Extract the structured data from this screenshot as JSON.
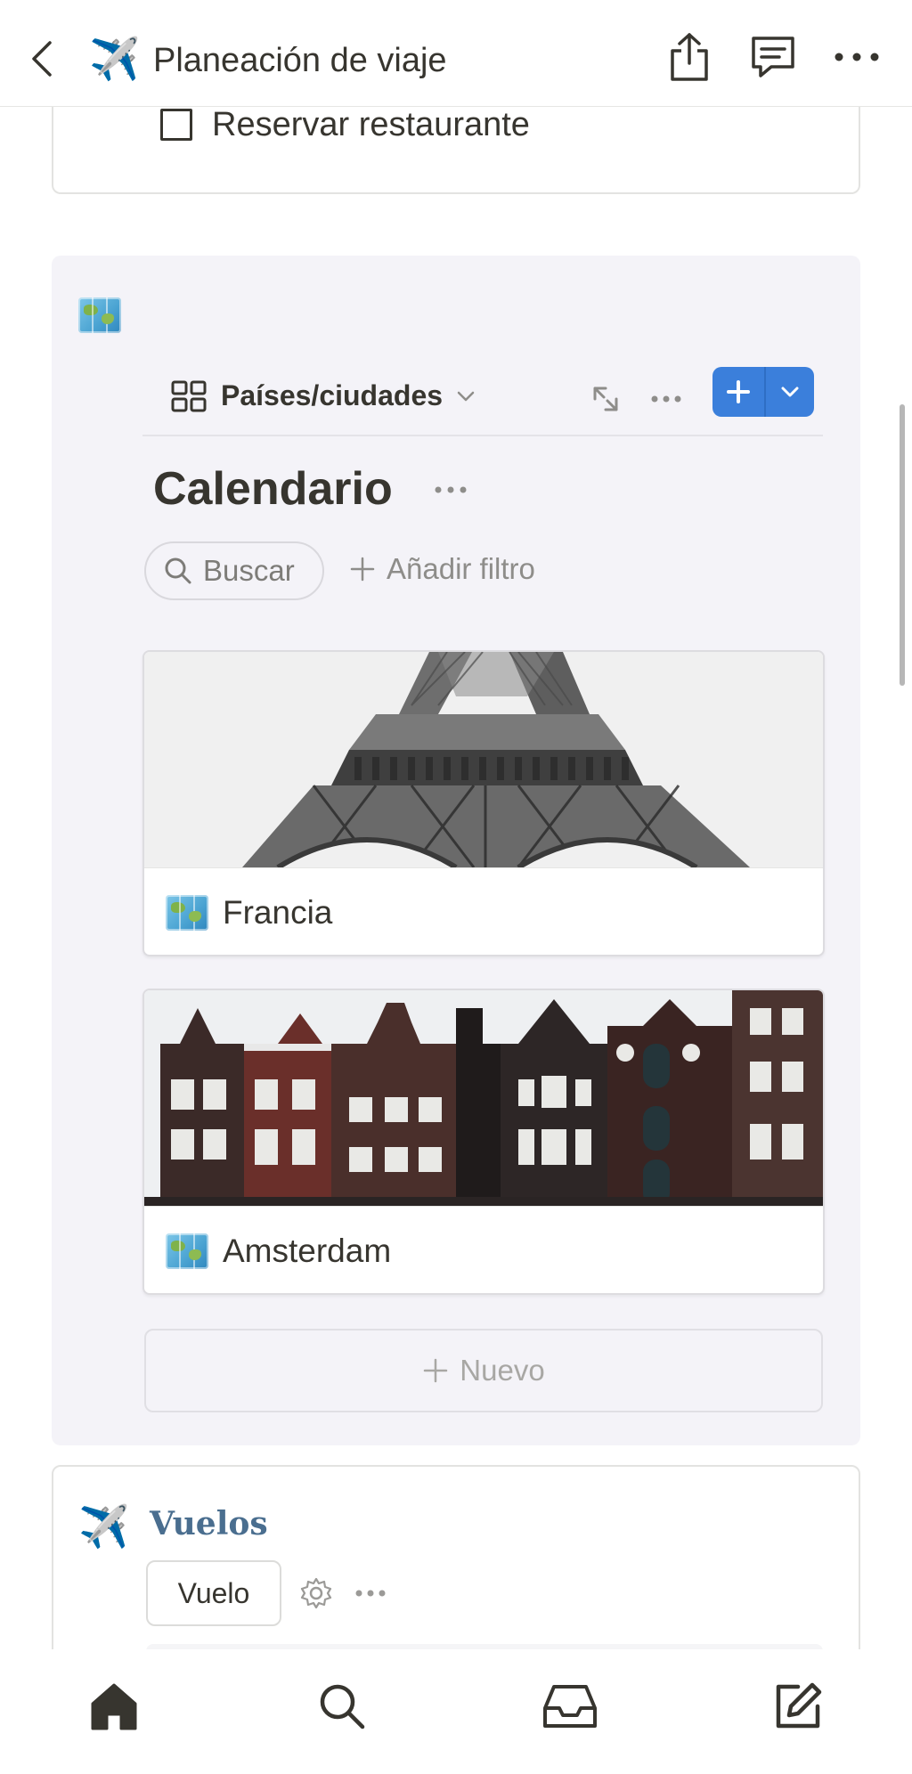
{
  "header": {
    "title": "Planeación de viaje",
    "page_icon": "✈️",
    "back_icon": "chevron-left-icon",
    "share_icon": "share-icon",
    "comment_icon": "comment-icon",
    "more_icon": "more-icon"
  },
  "checklist": {
    "item_label": "Reservar restaurante",
    "checked": false
  },
  "database": {
    "icon": "map-icon",
    "view_name": "Países/ciudades",
    "title": "Calendario",
    "search_label": "Buscar",
    "add_filter_label": "Añadir filtro",
    "new_label": "Nuevo",
    "accent_color": "#3b7fdb",
    "cards": [
      {
        "name": "Francia",
        "cover": "eiffel-tower-photo"
      },
      {
        "name": "Amsterdam",
        "cover": "amsterdam-houses-photo"
      }
    ]
  },
  "vuelos": {
    "icon": "✈️",
    "title": "Vuelos",
    "button_label": "Vuelo",
    "title_color": "#4a6e8f"
  },
  "bottom_nav": {
    "items": [
      "home-icon",
      "search-icon",
      "inbox-icon",
      "compose-icon"
    ]
  }
}
